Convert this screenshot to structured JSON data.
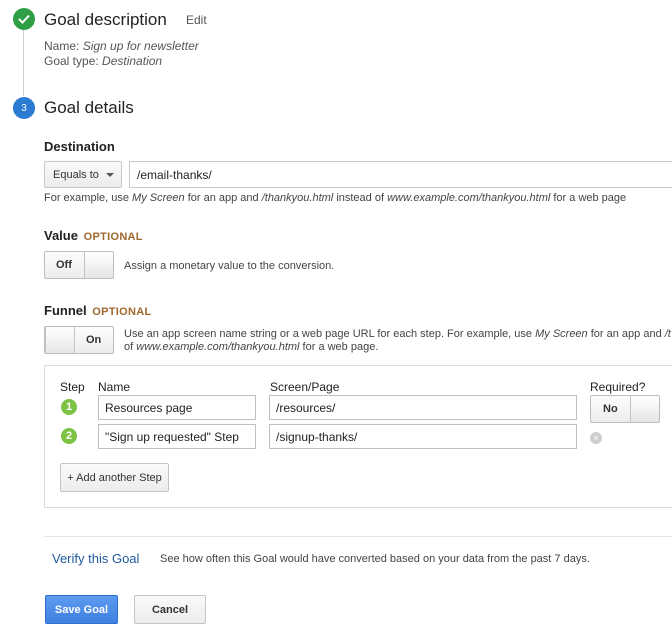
{
  "steps": {
    "description": {
      "title": "Goal description",
      "edit_label": "Edit",
      "name_label": "Name:",
      "name_value": "Sign up for newsletter",
      "type_label": "Goal type:",
      "type_value": "Destination"
    },
    "details": {
      "number": "3",
      "title": "Goal details"
    }
  },
  "destination": {
    "label": "Destination",
    "match_type": "Equals to",
    "value": "/email-thanks/",
    "hint_pre": "For example, use",
    "hint_app": "My Screen",
    "hint_mid": "for an app and",
    "hint_page": "/thankyou.html",
    "hint_mid2": "instead of",
    "hint_url": "www.example.com/thankyou.html",
    "hint_post": "for a web page"
  },
  "value_section": {
    "label": "Value",
    "optional": "OPTIONAL",
    "toggle_state": "Off",
    "description": "Assign a monetary value to the conversion."
  },
  "funnel": {
    "label": "Funnel",
    "optional": "OPTIONAL",
    "toggle_state": "On",
    "desc_line1_pre": "Use an app screen name string or a web page URL for each step. For example, use",
    "desc_line1_app": "My Screen",
    "desc_line1_post": "for an app and",
    "desc_line1_tail": "/t",
    "desc_line2_pre": "of",
    "desc_line2_url": "www.example.com/thankyou.html",
    "desc_line2_post": "for a web page.",
    "headers": {
      "step": "Step",
      "name": "Name",
      "screen": "Screen/Page",
      "required": "Required?"
    },
    "rows": [
      {
        "step": "1",
        "name": "Resources page",
        "screen": "/resources/",
        "required": "No"
      },
      {
        "step": "2",
        "name": "\"Sign up requested\" Step",
        "screen": "/signup-thanks/"
      }
    ],
    "add_step_label": "+ Add another Step"
  },
  "verify": {
    "link_label": "Verify this Goal",
    "description": "See how often this Goal would have converted based on your data from the past 7 days."
  },
  "actions": {
    "save_label": "Save Goal",
    "cancel_label": "Cancel"
  }
}
